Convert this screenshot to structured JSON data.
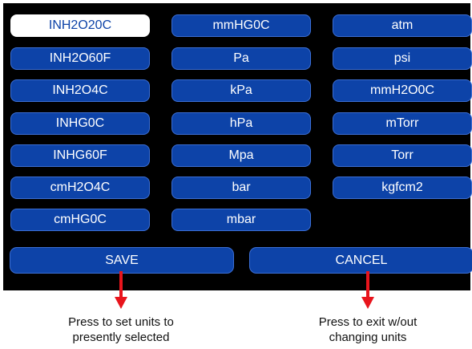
{
  "units": [
    {
      "label": "INH2O20C",
      "selected": true
    },
    {
      "label": "mmHG0C"
    },
    {
      "label": "atm"
    },
    {
      "label": "INH2O60F"
    },
    {
      "label": "Pa"
    },
    {
      "label": "psi"
    },
    {
      "label": "INH2O4C"
    },
    {
      "label": "kPa"
    },
    {
      "label": "mmH2O0C"
    },
    {
      "label": "INHG0C"
    },
    {
      "label": "hPa"
    },
    {
      "label": "mTorr"
    },
    {
      "label": "INHG60F"
    },
    {
      "label": "Mpa"
    },
    {
      "label": "Torr"
    },
    {
      "label": "cmH2O4C"
    },
    {
      "label": "bar"
    },
    {
      "label": "kgfcm2"
    },
    {
      "label": "cmHG0C"
    },
    {
      "label": "mbar"
    }
  ],
  "actions": {
    "save_label": "SAVE",
    "cancel_label": "CANCEL"
  },
  "annotations": {
    "save_caption_line1": "Press to set units to",
    "save_caption_line2": "presently selected",
    "cancel_caption_line1": "Press to exit w/out",
    "cancel_caption_line2": "changing units"
  },
  "colors": {
    "panel_background": "#000000",
    "button_fill": "#0d43a8",
    "button_border": "#3b6ed4",
    "selected_fill": "#ffffff",
    "selected_text": "#0d43a8",
    "arrow": "#e8141c"
  }
}
